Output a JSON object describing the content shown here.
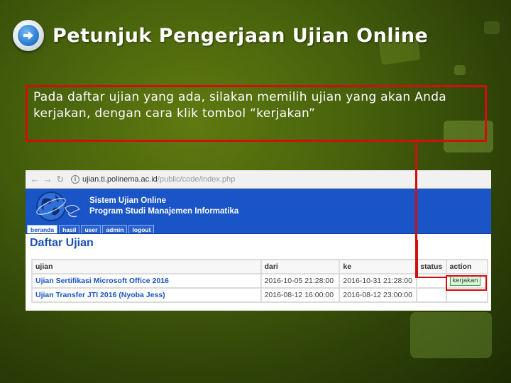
{
  "slide": {
    "title": "Petunjuk Pengerjaan Ujian Online",
    "instruction": "Pada daftar ujian yang ada, silakan memilih ujian yang akan Anda kerjakan, dengan cara klik tombol “kerjakan”"
  },
  "browser": {
    "url_main": "ujian.ti.polinema.ac.id",
    "url_rest": "/public/code/index.php"
  },
  "site": {
    "name": "Sistem Ujian Online",
    "program": "Program Studi Manajemen Informatika",
    "tabs": [
      "beranda",
      "hasil",
      "user",
      "admin",
      "logout"
    ],
    "page_title": "Daftar Ujian"
  },
  "table": {
    "headers": [
      "ujian",
      "dari",
      "ke",
      "status",
      "action"
    ],
    "rows": [
      {
        "ujian": "Ujian Sertifikasi Microsoft Office 2016",
        "dari": "2016-10-05 21:28:00",
        "ke": "2016-10-31 21:28:00",
        "status": "",
        "action": "kerjakan"
      },
      {
        "ujian": "Ujian Transfer JTI 2016 (Nyoba Jess)",
        "dari": "2016-08-12 16:00:00",
        "ke": "2016-08-12 23:00:00",
        "status": "",
        "action": ""
      }
    ]
  },
  "colors": {
    "accent_red": "#d10f0f",
    "site_blue": "#1a55c7",
    "background_green": "#48620c"
  },
  "icons": [
    "arrow-right-icon",
    "back-icon",
    "forward-icon",
    "reload-icon",
    "info-icon",
    "globe-logo-icon"
  ]
}
